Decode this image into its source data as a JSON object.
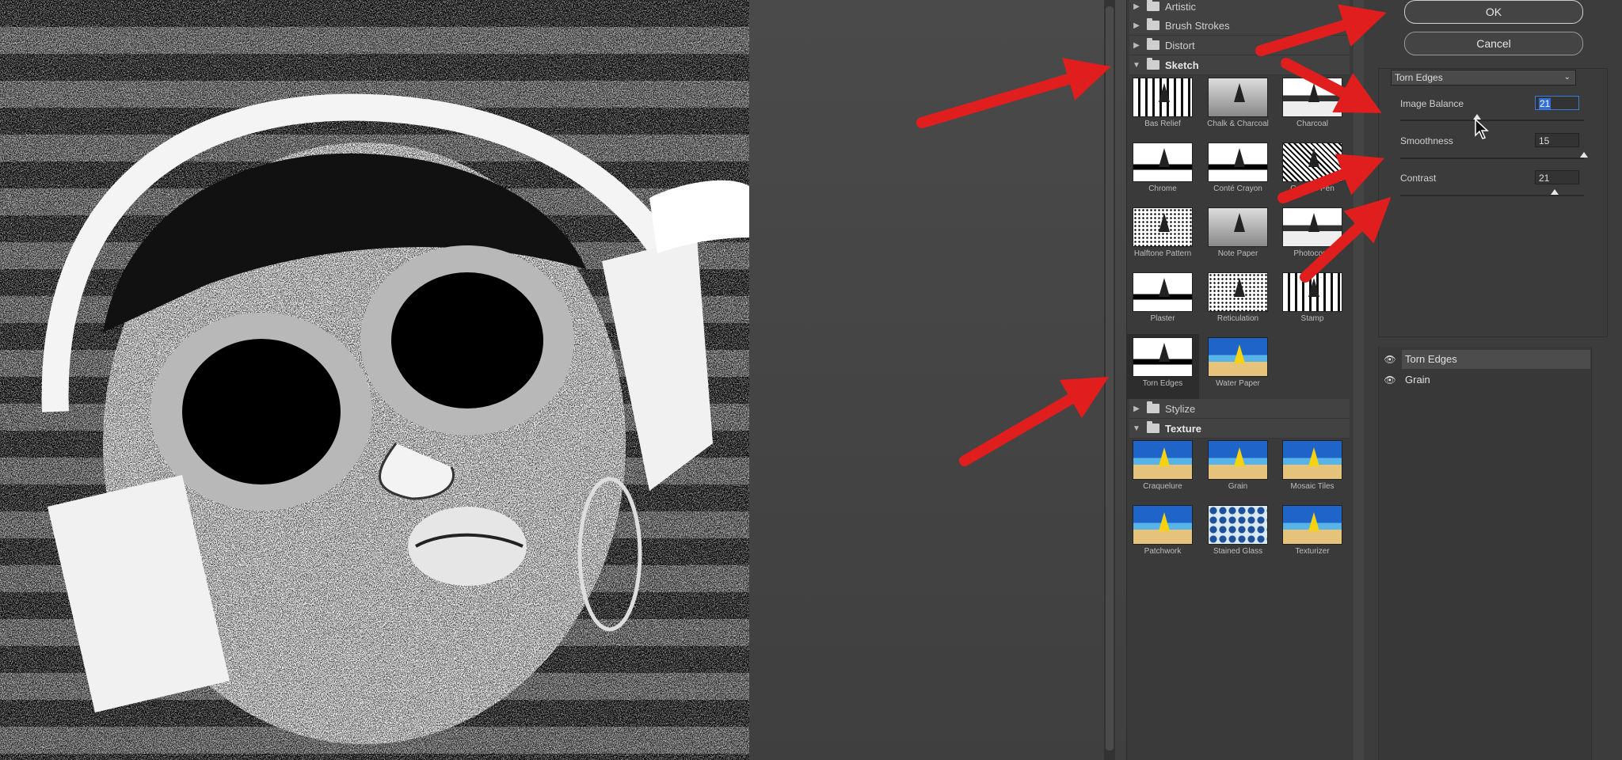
{
  "gallery": {
    "categories": {
      "artistic": "Artistic",
      "brush_strokes": "Brush Strokes",
      "distort": "Distort",
      "sketch": "Sketch",
      "stylize": "Stylize",
      "texture": "Texture"
    },
    "sketch_items": [
      "Bas Relief",
      "Chalk & Charcoal",
      "Charcoal",
      "Chrome",
      "Conté Crayon",
      "Graphic Pen",
      "Halftone Pattern",
      "Note Paper",
      "Photocopy",
      "Plaster",
      "Reticulation",
      "Stamp",
      "Torn Edges",
      "Water Paper"
    ],
    "texture_items": [
      "Craquelure",
      "Grain",
      "Mosaic Tiles",
      "Patchwork",
      "Stained Glass",
      "Texturizer"
    ],
    "selected": "Torn Edges"
  },
  "buttons": {
    "ok": "OK",
    "cancel": "Cancel"
  },
  "settings": {
    "filter": "Torn Edges",
    "image_balance_label": "Image Balance",
    "image_balance_value": "21",
    "smoothness_label": "Smoothness",
    "smoothness_value": "15",
    "contrast_label": "Contrast",
    "contrast_value": "21",
    "image_balance_level": 0.42,
    "smoothness_level": 1.0,
    "contrast_level": 0.84
  },
  "layers": {
    "items": [
      "Torn Edges",
      "Grain"
    ]
  },
  "colors": {
    "panel": "#3c3c3c",
    "accent": "#2f6fd6",
    "annotation_arrow": "#e01e1e"
  },
  "icons": {
    "visibility": "eye-icon",
    "folder": "folder-icon",
    "expand": "triangle-icon"
  }
}
